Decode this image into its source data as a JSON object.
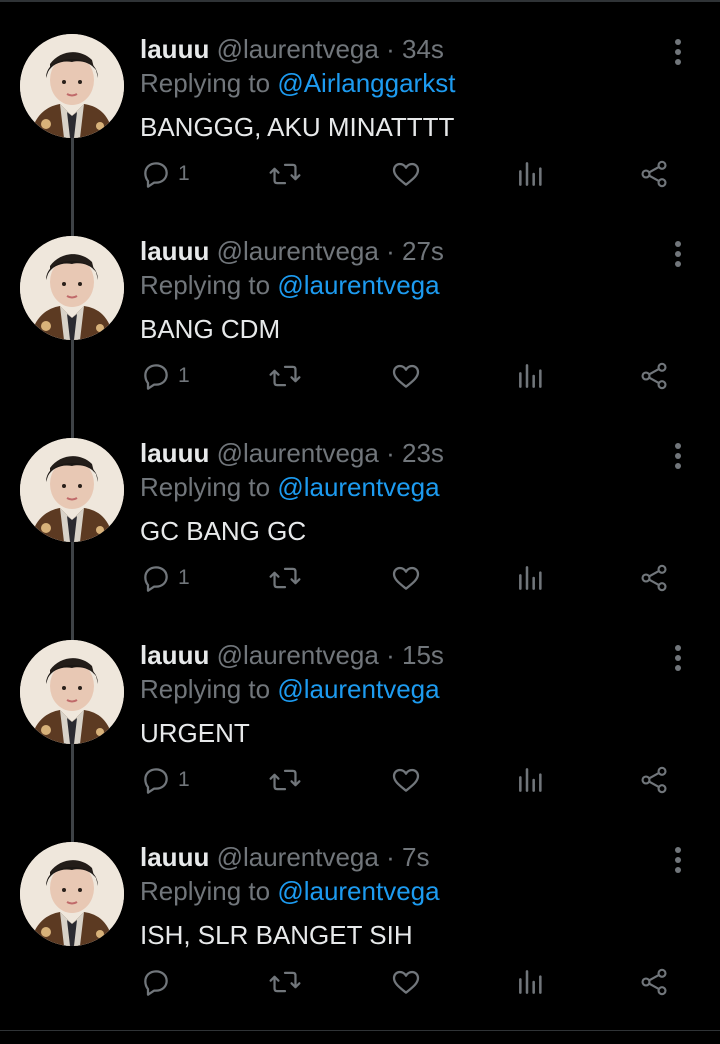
{
  "tweets": [
    {
      "name": "lauuu",
      "handle": "@laurentvega",
      "time": "34s",
      "replying_prefix": "Replying to",
      "replying_to": "@Airlanggarkst",
      "text": "BANGGG, AKU MINATTTT",
      "reply_count": "1"
    },
    {
      "name": "lauuu",
      "handle": "@laurentvega",
      "time": "27s",
      "replying_prefix": "Replying to",
      "replying_to": "@laurentvega",
      "text": "BANG CDM",
      "reply_count": "1"
    },
    {
      "name": "lauuu",
      "handle": "@laurentvega",
      "time": "23s",
      "replying_prefix": "Replying to",
      "replying_to": "@laurentvega",
      "text": "GC BANG GC",
      "reply_count": "1"
    },
    {
      "name": "lauuu",
      "handle": "@laurentvega",
      "time": "15s",
      "replying_prefix": "Replying to",
      "replying_to": "@laurentvega",
      "text": "URGENT",
      "reply_count": "1"
    },
    {
      "name": "lauuu",
      "handle": "@laurentvega",
      "time": "7s",
      "replying_prefix": "Replying to",
      "replying_to": "@laurentvega",
      "text": "ISH, SLR BANGET SIH",
      "reply_count": ""
    }
  ],
  "separator": "·",
  "icons": {
    "reply": "reply-icon",
    "retweet": "retweet-icon",
    "like": "heart-icon",
    "analytics": "analytics-icon",
    "share": "share-icon",
    "more": "more-vertical-icon"
  },
  "colors": {
    "background": "#000000",
    "text": "#e7e9ea",
    "muted": "#71767b",
    "mention": "#1d9bf0",
    "thread_line": "#3e4246"
  }
}
